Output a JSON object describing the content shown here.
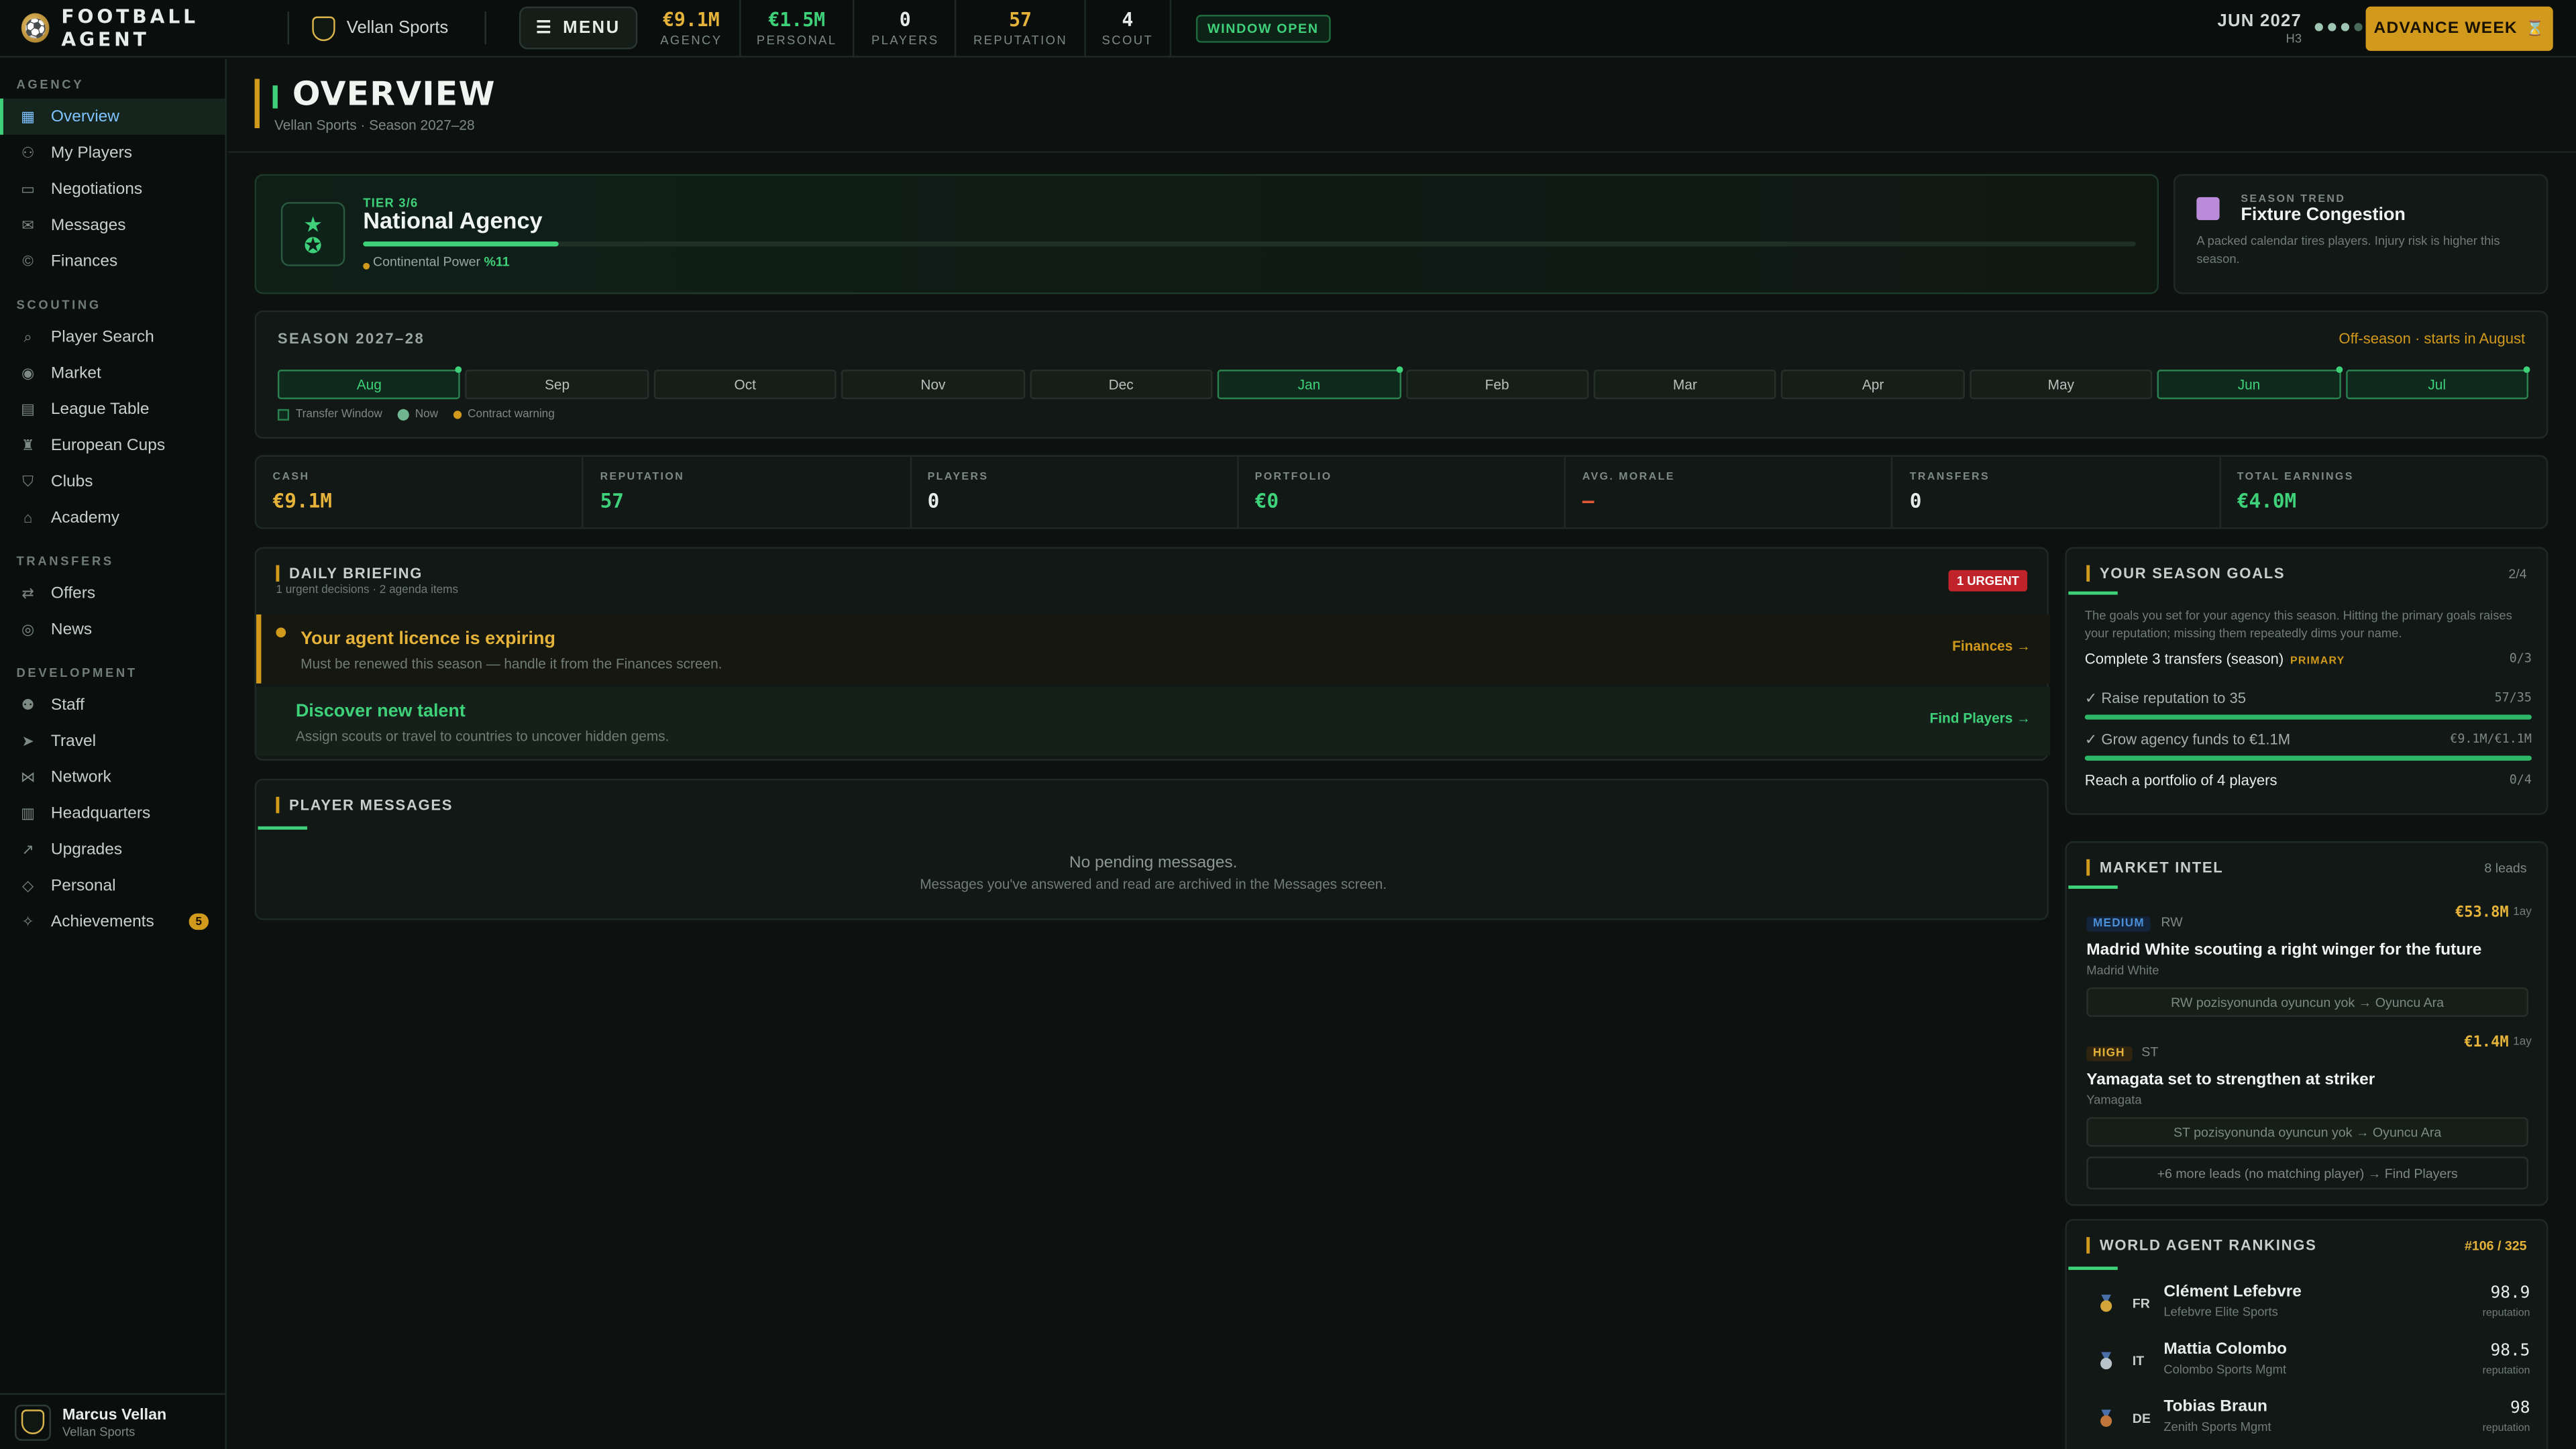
{
  "app": {
    "brand": "FOOTBALL AGENT",
    "club": "Vellan Sports",
    "menu_label": "MENU"
  },
  "topstats": [
    {
      "value": "€9.1M",
      "label": "AGENCY",
      "color": "#e5b23a"
    },
    {
      "value": "€1.5M",
      "label": "PERSONAL",
      "color": "#3ed17a"
    },
    {
      "value": "0",
      "label": "PLAYERS",
      "color": "#e6ece8"
    },
    {
      "value": "57",
      "label": "REPUTATION",
      "color": "#e5b23a"
    },
    {
      "value": "4",
      "label": "SCOUT",
      "color": "#e6ece8"
    }
  ],
  "window_status": "WINDOW OPEN",
  "date": {
    "label": "JUN 2027",
    "sub": "H3"
  },
  "advance_label": "ADVANCE WEEK",
  "sidebar": {
    "sections": [
      {
        "title": "AGENCY",
        "items": [
          {
            "label": "Overview",
            "icon": "grid-icon",
            "active": true
          },
          {
            "label": "My Players",
            "icon": "user-icon"
          },
          {
            "label": "Negotiations",
            "icon": "chat-icon"
          },
          {
            "label": "Messages",
            "icon": "mail-icon"
          },
          {
            "label": "Finances",
            "icon": "coin-icon"
          }
        ]
      },
      {
        "title": "SCOUTING",
        "items": [
          {
            "label": "Player Search",
            "icon": "search-icon"
          },
          {
            "label": "Market",
            "icon": "radio-icon"
          },
          {
            "label": "League Table",
            "icon": "table-icon"
          },
          {
            "label": "European Cups",
            "icon": "trophy-icon"
          },
          {
            "label": "Clubs",
            "icon": "shield-icon"
          },
          {
            "label": "Academy",
            "icon": "graduation-icon"
          }
        ]
      },
      {
        "title": "TRANSFERS",
        "items": [
          {
            "label": "Offers",
            "icon": "swap-icon"
          },
          {
            "label": "News",
            "icon": "globe-icon"
          }
        ]
      },
      {
        "title": "DEVELOPMENT",
        "items": [
          {
            "label": "Staff",
            "icon": "users-icon"
          },
          {
            "label": "Travel",
            "icon": "plane-icon"
          },
          {
            "label": "Network",
            "icon": "network-icon"
          },
          {
            "label": "Headquarters",
            "icon": "building-icon"
          },
          {
            "label": "Upgrades",
            "icon": "trend-icon"
          },
          {
            "label": "Personal",
            "icon": "diamond-icon"
          },
          {
            "label": "Achievements",
            "icon": "medal-icon",
            "badge": "5"
          }
        ]
      }
    ]
  },
  "user": {
    "name": "Marcus Vellan",
    "agency": "Vellan Sports"
  },
  "page": {
    "title": "OVERVIEW",
    "subtitle": "Vellan Sports · Season 2027–28"
  },
  "tier": {
    "label": "TIER 3/6",
    "name": "National Agency",
    "progress": 0.11,
    "power_label": "Continental Power",
    "power_value": "%11"
  },
  "trend": {
    "kicker": "SEASON TREND",
    "title": "Fixture Congestion",
    "desc": "A packed calendar tires players. Injury risk is higher this season."
  },
  "season": {
    "title": "SEASON 2027–28",
    "status": "Off-season · starts in August",
    "months": [
      {
        "label": "Aug",
        "window": true,
        "contract": true
      },
      {
        "label": "Sep"
      },
      {
        "label": "Oct"
      },
      {
        "label": "Nov"
      },
      {
        "label": "Dec"
      },
      {
        "label": "Jan",
        "window": true,
        "contract": true
      },
      {
        "label": "Feb"
      },
      {
        "label": "Mar"
      },
      {
        "label": "Apr"
      },
      {
        "label": "May"
      },
      {
        "label": "Jun",
        "window": true,
        "contract": true
      },
      {
        "label": "Jul",
        "window": true,
        "contract": true
      }
    ],
    "legend": {
      "window": "Transfer Window",
      "now": "Now",
      "contract": "Contract warning"
    }
  },
  "kpis": [
    {
      "label": "CASH",
      "value": "€9.1M",
      "color": "#e5b23a"
    },
    {
      "label": "REPUTATION",
      "value": "57",
      "color": "#3ed17a"
    },
    {
      "label": "PLAYERS",
      "value": "0",
      "color": "#e6ece8"
    },
    {
      "label": "PORTFOLIO",
      "value": "€0",
      "color": "#3ed17a"
    },
    {
      "label": "AVG. MORALE",
      "value": "—",
      "color": "#e05a3a"
    },
    {
      "label": "TRANSFERS",
      "value": "0",
      "color": "#e6ece8"
    },
    {
      "label": "TOTAL EARNINGS",
      "value": "€4.0M",
      "color": "#3ed17a"
    }
  ],
  "daily": {
    "title": "DAILY BRIEFING",
    "sub": "1 urgent decisions · 2 agenda items",
    "urgent": "1 URGENT",
    "items": [
      {
        "title": "Your agent licence is expiring",
        "desc": "Must be renewed this season — handle it from the Finances screen.",
        "action": "Finances →"
      },
      {
        "title": "Discover new talent",
        "desc": "Assign scouts or travel to countries to uncover hidden gems.",
        "action": "Find Players →"
      }
    ]
  },
  "messages": {
    "title": "PLAYER MESSAGES",
    "empty": "No pending messages.",
    "empty_sub": "Messages you've answered and read are archived in the Messages screen."
  },
  "goals": {
    "title": "YOUR SEASON GOALS",
    "count": "2/4",
    "intro": "The goals you set for your agency this season. Hitting the primary goals raises your reputation; missing them repeatedly dims your name.",
    "items": [
      {
        "name": "Complete 3 transfers (season)",
        "tag": "PRIMARY",
        "value": "0/3",
        "progress": 0,
        "done": false
      },
      {
        "name": "✓ Raise reputation to 35",
        "value": "57/35",
        "progress": 1,
        "done": true
      },
      {
        "name": "✓ Grow agency funds to €1.1M",
        "value": "€9.1M/€1.1M",
        "progress": 1,
        "done": true
      },
      {
        "name": "Reach a portfolio of 4 players",
        "value": "0/4",
        "progress": 0,
        "done": false
      }
    ]
  },
  "market": {
    "title": "MARKET INTEL",
    "count": "8 leads",
    "leads": [
      {
        "priority": "MEDIUM",
        "pcolor": "#4a8fd8",
        "pbg": "#13243a",
        "position": "RW",
        "fee": "€53.8M",
        "age": "1ay",
        "headline": "Madrid White scouting a right winger for the future",
        "club": "Madrid White",
        "cta": "RW pozisyonunda oyuncun yok → Oyuncu Ara"
      },
      {
        "priority": "HIGH",
        "pcolor": "#e5b23a",
        "pbg": "#2e2410",
        "position": "ST",
        "fee": "€1.4M",
        "age": "1ay",
        "headline": "Yamagata set to strengthen at striker",
        "club": "Yamagata",
        "cta": "ST pozisyonunda oyuncun yok → Oyuncu Ara"
      }
    ],
    "more": "+6 more leads (no matching player) → Find Players"
  },
  "rankings": {
    "title": "WORLD AGENT RANKINGS",
    "position": "#106 / 325",
    "agents": [
      {
        "country": "FR",
        "name": "Clément Lefebvre",
        "agency": "Lefebvre Elite Sports",
        "score": "98.9",
        "unit": "reputation",
        "medal": "#d4a63a"
      },
      {
        "country": "IT",
        "name": "Mattia Colombo",
        "agency": "Colombo Sports Mgmt",
        "score": "98.5",
        "unit": "reputation",
        "medal": "#b9c3cc"
      },
      {
        "country": "DE",
        "name": "Tobias Braun",
        "agency": "Zenith Sports Mgmt",
        "score": "98",
        "unit": "reputation",
        "medal": "#c0763a"
      }
    ]
  }
}
